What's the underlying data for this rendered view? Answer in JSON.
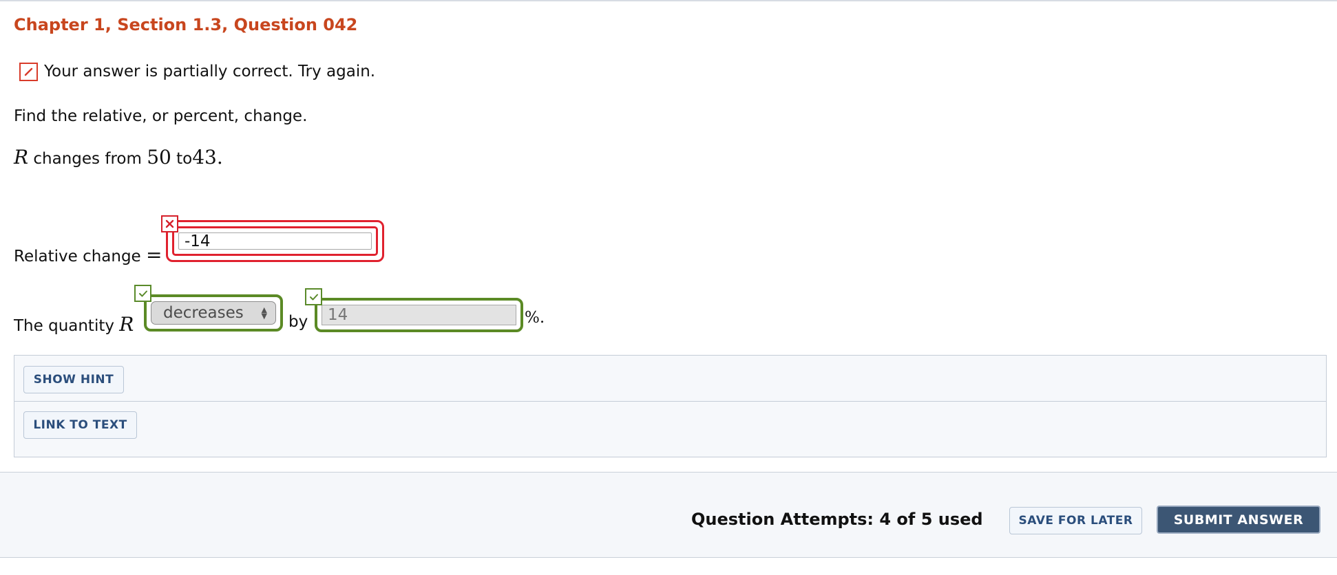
{
  "header": {
    "title": "Chapter 1, Section 1.3, Question 042"
  },
  "feedback": {
    "message": "Your answer is partially correct.  Try again.",
    "status_color": "#d83b2a"
  },
  "question": {
    "instruction": "Find the relative, or percent, change.",
    "problem": {
      "variable": "R",
      "text_changes_from": "changes from",
      "from_value": "50",
      "text_to": "to",
      "to_value": "43",
      "end": "."
    }
  },
  "answers": {
    "relative_change": {
      "label": "Relative change",
      "equals": "=",
      "value": "-14",
      "status": "incorrect"
    },
    "quantity": {
      "label_prefix": "The quantity",
      "variable": "R",
      "direction_value": "decreases",
      "direction_status": "correct",
      "by_label": "by",
      "percent_value": "14",
      "percent_status": "correct",
      "percent_suffix": "%."
    }
  },
  "help_panel": {
    "show_hint_label": "SHOW HINT",
    "link_to_text_label": "LINK TO TEXT"
  },
  "footer": {
    "attempts_text": "Question Attempts: 4 of 5 used",
    "save_label": "SAVE FOR LATER",
    "submit_label": "SUBMIT ANSWER"
  },
  "colors": {
    "title": "#c8461e",
    "incorrect": "#e0212e",
    "correct": "#5b8a25",
    "primary_button": "#3c5674",
    "link_text": "#2b4e7c"
  },
  "icons": {
    "feedback": "pencil-icon",
    "incorrect": "x-mark-icon",
    "correct": "check-mark-icon"
  }
}
